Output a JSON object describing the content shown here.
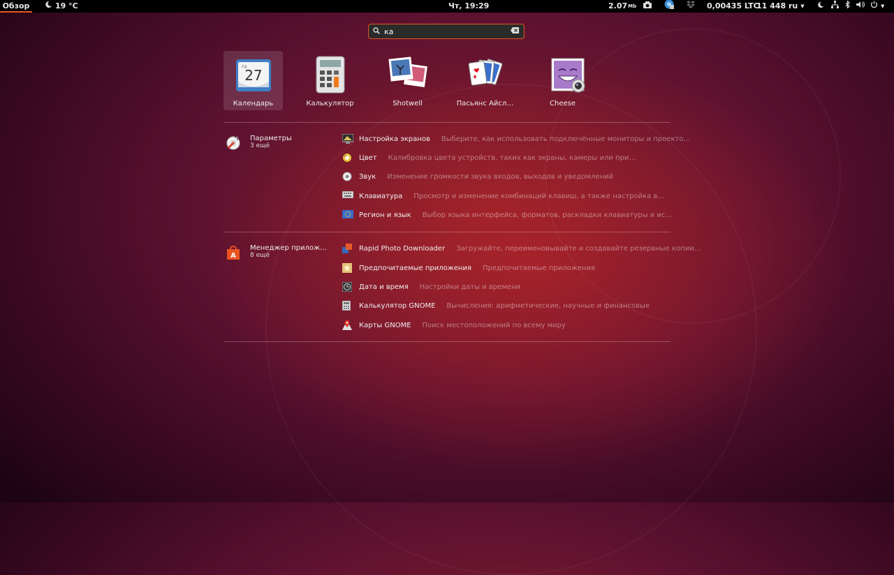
{
  "topbar": {
    "activities": "Обзор",
    "weather": "19 °C",
    "clock": "Чт, 19:29",
    "net_speed": "2.07",
    "net_unit": "Mb",
    "crypto": "0,00435 LTC",
    "counter": "11 448",
    "language": "ru"
  },
  "search": {
    "query": "ка"
  },
  "apps": [
    {
      "label": "Календарь",
      "day": "27",
      "month": "FB"
    },
    {
      "label": "Калькулятор"
    },
    {
      "label": "Shotwell"
    },
    {
      "label": "Пасьянс Айсл…"
    },
    {
      "label": "Cheese"
    }
  ],
  "sections": [
    {
      "name": "Параметры",
      "more": "3 ещё",
      "results": [
        {
          "title": "Настройка экранов",
          "desc": "Выберите, как использовать подключённые мониторы и проекторы"
        },
        {
          "title": "Цвет",
          "desc": "Калибровка цвета устройств, таких как экраны, камеры или принтеры"
        },
        {
          "title": "Звук",
          "desc": "Изменение громкости звука входов, выходов и уведомлений"
        },
        {
          "title": "Клавиатура",
          "desc": "Просмотр и изменение комбинаций клавиш, а также настройка ввода"
        },
        {
          "title": "Регион и язык",
          "desc": "Выбор языка интерфейса, форматов, раскладки клавиатуры и источник…"
        }
      ]
    },
    {
      "name": "Менеджер прилож…",
      "more": "8 ещё",
      "results": [
        {
          "title": "Rapid Photo Downloader",
          "desc": "Загружайте, переименовывайте и создавайте резервные копии…"
        },
        {
          "title": "Предпочитаемые приложения",
          "desc": "Предпочитаемые приложения"
        },
        {
          "title": "Дата и время",
          "desc": "Настройки даты и времени"
        },
        {
          "title": "Калькулятор GNOME",
          "desc": "Вычисления: арифметические, научные и финансовые"
        },
        {
          "title": "Карты GNOME",
          "desc": "Поиск местоположений по всему миру"
        }
      ]
    }
  ],
  "colors": {
    "accent": "#e95420",
    "topbar": "#000000"
  }
}
